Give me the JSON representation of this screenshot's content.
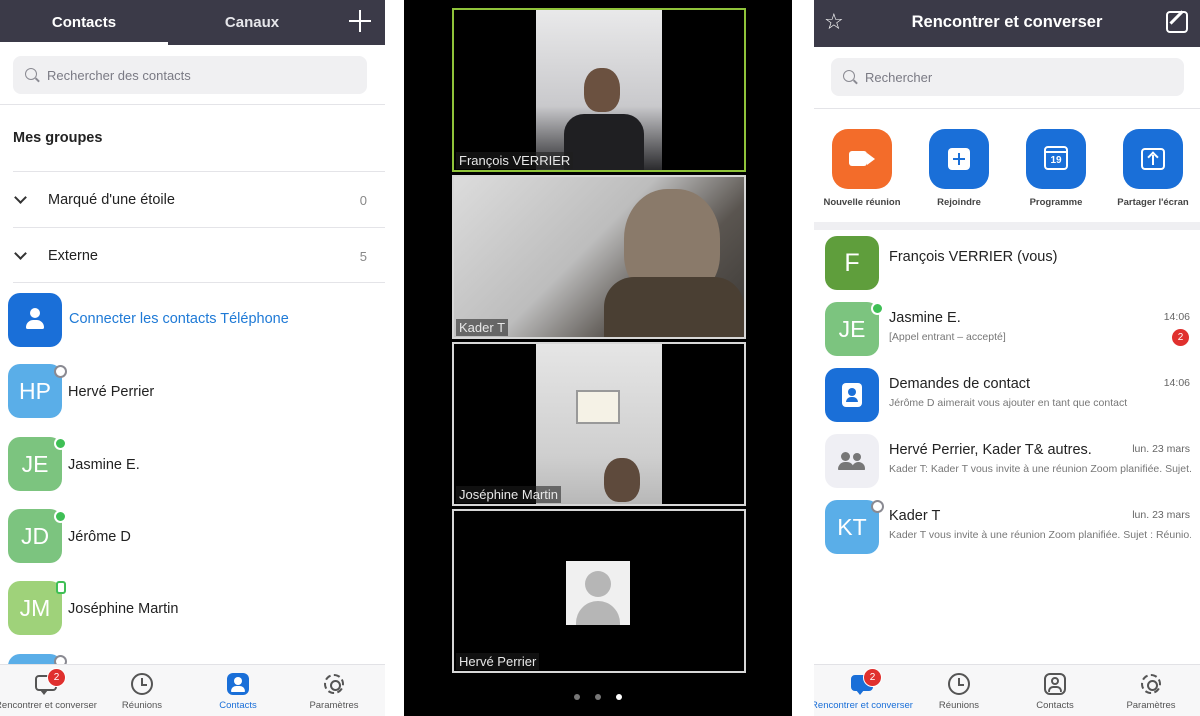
{
  "contacts_screen": {
    "tabs": [
      {
        "label": "Contacts"
      },
      {
        "label": "Canaux"
      }
    ],
    "search_placeholder": "Rechercher des contacts",
    "groups_title": "Mes groupes",
    "groups": [
      {
        "label": "Marqué d'une étoile",
        "count": "0"
      },
      {
        "label": "Externe",
        "count": "5"
      }
    ],
    "connect_phone_label": "Connecter les contacts Téléphone",
    "contacts": [
      {
        "initials": "HP",
        "name": "Hervé Perrier",
        "color": "#5aaee8",
        "presence": "offline"
      },
      {
        "initials": "JE",
        "name": "Jasmine E.",
        "color": "#7cc47f",
        "presence": "online"
      },
      {
        "initials": "JD",
        "name": "Jérôme D",
        "color": "#7cc47f",
        "presence": "online"
      },
      {
        "initials": "JM",
        "name": "Joséphine Martin",
        "color": "#9fd27a",
        "presence": "mobile"
      }
    ],
    "tabbar": {
      "meet_label": "Rencontrer et converser",
      "meetings_label": "Réunions",
      "contacts_label": "Contacts",
      "settings_label": "Paramètres",
      "badge": "2"
    }
  },
  "call_screen": {
    "participants": [
      {
        "name": "François VERRIER",
        "speaking": true
      },
      {
        "name": "Kader T",
        "speaking": false
      },
      {
        "name": "Joséphine Martin",
        "speaking": false
      },
      {
        "name": "Hervé Perrier",
        "speaking": false
      }
    ],
    "page_count": 3,
    "active_page": 3
  },
  "meet_screen": {
    "title": "Rencontrer et converser",
    "search_placeholder": "Rechercher",
    "actions": [
      {
        "label": "Nouvelle réunion",
        "icon": "video-camera-icon",
        "color": "#f36c2a"
      },
      {
        "label": "Rejoindre",
        "icon": "join-plus-icon",
        "color": "#1a6fd8"
      },
      {
        "label": "Programme",
        "icon": "calendar-icon",
        "color": "#1a6fd8",
        "day": "19"
      },
      {
        "label": "Partager l'écran",
        "icon": "share-screen-icon",
        "color": "#1a6fd8"
      }
    ],
    "chats": [
      {
        "initials": "F",
        "color": "#5f9e3c",
        "name": "François VERRIER (vous)",
        "preview": "",
        "time": "",
        "badge": "",
        "presence": ""
      },
      {
        "initials": "JE",
        "color": "#7cc47f",
        "name": "Jasmine E.",
        "preview": "[Appel entrant – accepté]",
        "time": "14:06",
        "badge": "2",
        "presence": "online"
      },
      {
        "initials": "",
        "color": "#1a6fd8",
        "name": "Demandes de contact",
        "preview": "Jérôme D aimerait vous ajouter en tant que contact",
        "time": "14:06",
        "badge": "",
        "presence": ""
      },
      {
        "initials": "",
        "color": "#efeff4",
        "name": "Hervé Perrier, Kader T& autres.",
        "preview": "Kader T: Kader T vous invite à une réunion Zoom planifiée. Sujet...",
        "time": "lun. 23 mars",
        "badge": "",
        "presence": ""
      },
      {
        "initials": "KT",
        "color": "#5aaee8",
        "name": "Kader T",
        "preview": "Kader T vous invite à une réunion Zoom planifiée. Sujet : Réunio...",
        "time": "lun. 23 mars",
        "badge": "",
        "presence": "offline"
      }
    ],
    "tabbar": {
      "meet_label": "Rencontrer et converser",
      "meetings_label": "Réunions",
      "contacts_label": "Contacts",
      "settings_label": "Paramètres",
      "badge": "2"
    }
  }
}
